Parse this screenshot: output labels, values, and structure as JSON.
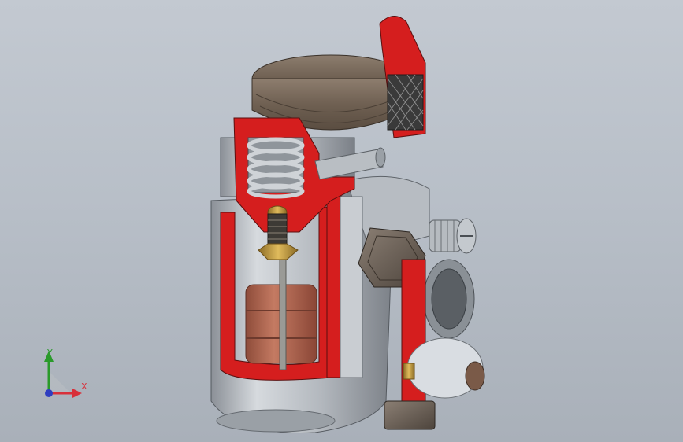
{
  "viewport": {
    "background_top": "#c3c9d1",
    "background_bottom": "#a9b0b9"
  },
  "colors": {
    "section_red": "#d51e1e",
    "body_grey": "#a9aeb4",
    "cap_bronze": "#7a6a5a",
    "coil_copper": "#b86a54",
    "brass": "#c9a14a"
  },
  "triad": {
    "x_label": "X",
    "y_label": "Y",
    "x_color": "#d8303a",
    "y_color": "#2a9a2a",
    "z_color": "#2f3ec0"
  }
}
